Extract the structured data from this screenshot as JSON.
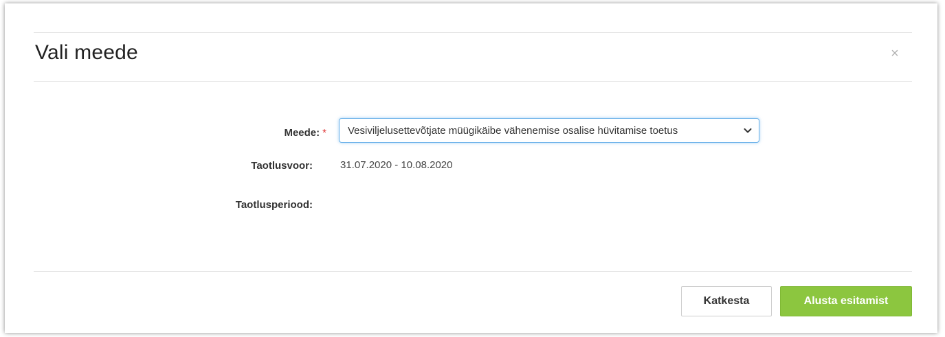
{
  "modal": {
    "title": "Vali meede",
    "close_glyph": "×"
  },
  "form": {
    "meede_label": "Meede:",
    "required_mark": "*",
    "meede_selected": "Vesiviljelusettevõtjate müügikäibe vähenemise osalise hüvitamise toetus",
    "taotlusvoor_label": "Taotlusvoor:",
    "taotlusvoor_value": "31.07.2020 - 10.08.2020",
    "taotlusperiood_label": "Taotlusperiood:"
  },
  "footer": {
    "cancel_label": "Katkesta",
    "start_label": "Alusta esitamist"
  },
  "colors": {
    "primary_button": "#8cc63f",
    "focus_border": "#66afe9",
    "required": "#e03a3a"
  },
  "icons": {
    "close": "close-icon",
    "dropdown": "chevron-down-icon"
  }
}
